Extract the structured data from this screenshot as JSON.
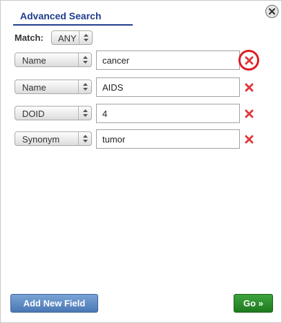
{
  "tab": {
    "label": "Advanced Search"
  },
  "match": {
    "label": "Match:",
    "value": "ANY"
  },
  "rows": [
    {
      "field": "Name",
      "value": "cancer"
    },
    {
      "field": "Name",
      "value": "AIDS"
    },
    {
      "field": "DOID",
      "value": "4"
    },
    {
      "field": "Synonym",
      "value": "tumor"
    }
  ],
  "buttons": {
    "add_label": "Add New Field",
    "go_label": "Go »"
  },
  "colors": {
    "tab_accent": "#1f3c8c",
    "remove_icon": "#e0383d",
    "highlight_ring": "#e01a22",
    "add_button": "#4a78b4",
    "go_button": "#1e7a1e"
  },
  "icons": {
    "close": "close-circle-icon",
    "remove": "red-x-icon",
    "select_arrow": "updown-arrow-icon"
  }
}
